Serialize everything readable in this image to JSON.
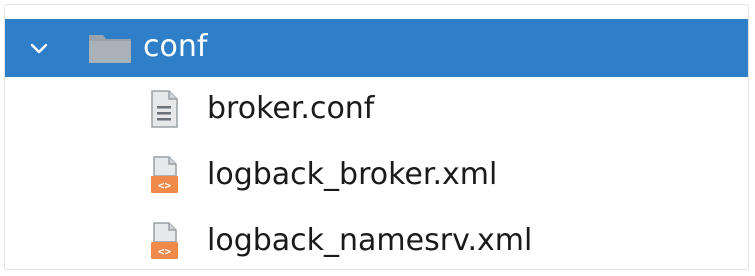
{
  "tree": {
    "folder": {
      "name": "conf",
      "icon": "folder-icon",
      "expanded": true,
      "selected": true,
      "highlight_color": "#2f7ec8"
    },
    "files": [
      {
        "name": "broker.conf",
        "icon": "text-file-icon"
      },
      {
        "name": "logback_broker.xml",
        "icon": "xml-file-icon",
        "icon_color": "#f08a4b"
      },
      {
        "name": "logback_namesrv.xml",
        "icon": "xml-file-icon",
        "icon_color": "#f08a4b"
      }
    ]
  }
}
